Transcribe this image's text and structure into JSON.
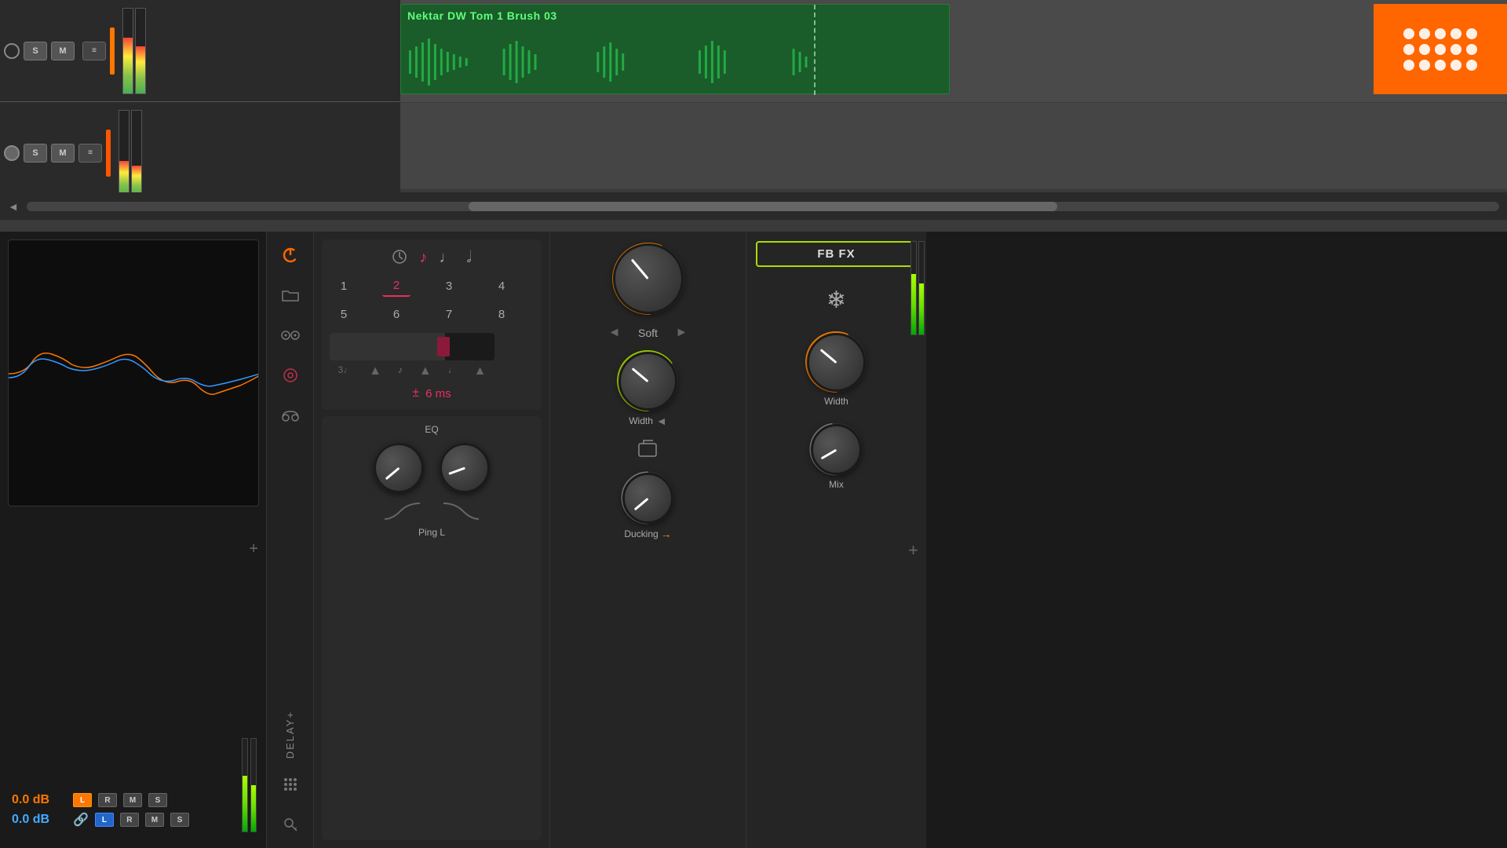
{
  "daw": {
    "track1": {
      "s_label": "S",
      "m_label": "M",
      "clip_name": "Nektar DW Tom 1 Brush 03"
    },
    "track2": {
      "s_label": "S",
      "m_label": "M"
    },
    "scroll_arrow": "◄"
  },
  "analyzer": {
    "level_orange": "0.0 dB",
    "level_blue": "0.0 dB",
    "l_label": "L",
    "r_label": "R",
    "m_label": "M",
    "s_label": "S"
  },
  "controls": {
    "delay_label": "DELAY+",
    "power_icon": "⏻",
    "folder_icon": "📁",
    "link_icon": "⊕",
    "radio_icon": "◎",
    "dots_icon": "⋮⋮",
    "key_icon": "🔑"
  },
  "delay": {
    "note_icons": [
      "♩",
      "♪",
      "♫",
      "♬"
    ],
    "active_note_index": 1,
    "numbers_row1": [
      "1",
      "2",
      "3",
      "4"
    ],
    "numbers_row2": [
      "5",
      "6",
      "7",
      "8"
    ],
    "active_number": "2",
    "offset_label": "±",
    "offset_value": "6 ms",
    "eq_label": "EQ",
    "ping_label": "Ping L"
  },
  "knobs": {
    "soft_label": "Soft",
    "width_label": "Width",
    "ducking_label": "Ducking",
    "mix_label": "Mix",
    "left_arrow": "◄",
    "right_arrow": "►",
    "back_icon": "↩"
  },
  "fbfx": {
    "title": "FB FX",
    "snowflake": "❄",
    "plus": "+"
  }
}
